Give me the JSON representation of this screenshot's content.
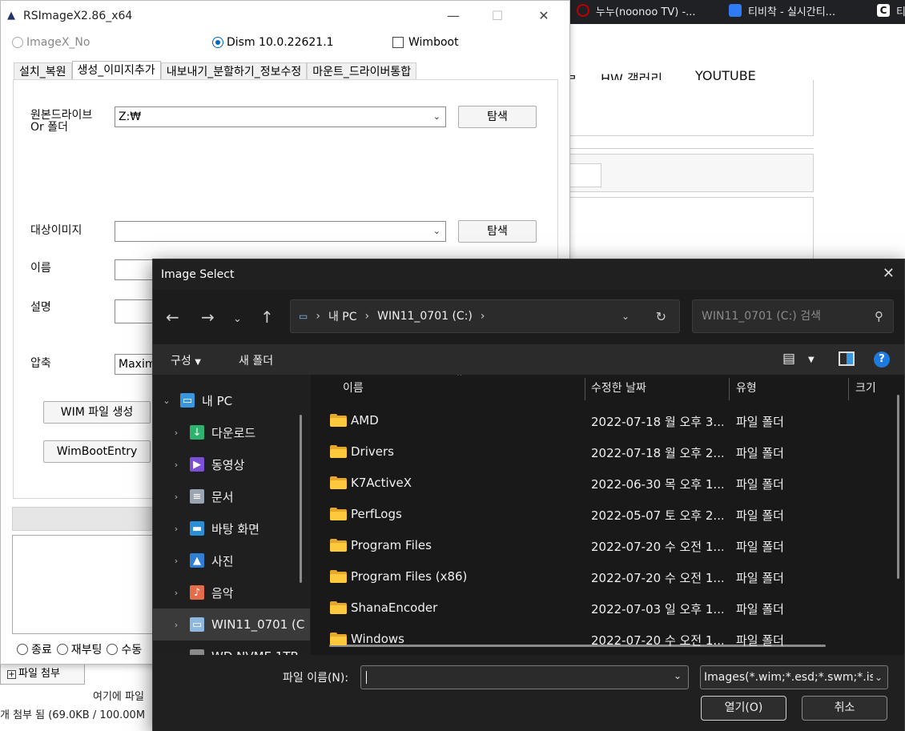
{
  "browser": {
    "tabs": [
      {
        "title": "누누(noonoo TV) -...",
        "icon_color": "#c00000"
      },
      {
        "title": "티비착 - 실시간티...",
        "icon_color": "#2f7bf5"
      },
      {
        "title": "티",
        "icon_color": "#111111"
      }
    ],
    "nav_links": [
      "HW 갤러리",
      "YOUTUBE"
    ],
    "partial_nav": "ㄹ",
    "attach_button": "파일 첨부",
    "attach_hint": "여기에 파일",
    "attach_status": "개 첨부 됨 (69.0KB / 100.00M"
  },
  "rsimagex": {
    "title": "RSImageX2.86_x64",
    "window_controls": {
      "minimize": "—",
      "maximize": "☐",
      "close": "✕"
    },
    "options": {
      "imagex_label": "ImageX_No",
      "dism_label": "Dism 10.0.22621.1",
      "wimboot_label": "Wimboot",
      "selected": "dism"
    },
    "tabs": [
      "설치_복원",
      "생성_이미지추가",
      "내보내기_분할하기_정보수정",
      "마운트_드라이버통합"
    ],
    "active_tab": "생성_이미지추가",
    "form": {
      "source_label_line1": "원본드라이브",
      "source_label_line2": "Or 폴더",
      "source_value": "Z:₩",
      "browse_label": "탐색",
      "target_label": "대상이미지",
      "target_value": "",
      "browse2_label": "탐색",
      "name_label": "이름",
      "desc_label": "설명",
      "compress_label": "압축",
      "compress_value": "Maxim",
      "create_wim_button": "WIM 파일 생성",
      "wimboot_entry_button": "WimBootEntry"
    },
    "bottom_options": [
      "종료",
      "재부팅",
      "수동"
    ]
  },
  "dialog": {
    "title": "Image Select",
    "address": {
      "root": "내 PC",
      "current": "WIN11_0701 (C:)"
    },
    "search_placeholder": "WIN11_0701 (C:) 검색",
    "toolbar": {
      "organize": "구성",
      "new_folder": "새 폴더"
    },
    "nav_items": [
      {
        "label": "내 PC",
        "icon": "pc-icon",
        "icon_color": "#3a96dd",
        "glyph": "▭"
      },
      {
        "label": "다운로드",
        "icon": "download-icon",
        "icon_color": "#2db36f",
        "glyph": "↓"
      },
      {
        "label": "동영상",
        "icon": "video-icon",
        "icon_color": "#7b4fd6",
        "glyph": "▶"
      },
      {
        "label": "문서",
        "icon": "document-icon",
        "icon_color": "#9aa4b2",
        "glyph": "≡"
      },
      {
        "label": "바탕 화면",
        "icon": "desktop-icon",
        "icon_color": "#2a8fd8",
        "glyph": "▬"
      },
      {
        "label": "사진",
        "icon": "photo-icon",
        "icon_color": "#2f7fd6",
        "glyph": "▲"
      },
      {
        "label": "음악",
        "icon": "music-icon",
        "icon_color": "#e56b4a",
        "glyph": "♪"
      },
      {
        "label": "WIN11_0701 (C",
        "icon": "drive-icon",
        "icon_color": "#8fb8e0",
        "glyph": "▭"
      },
      {
        "label": "WD NVME 1TB",
        "icon": "drive-icon",
        "icon_color": "#8a8a8a",
        "glyph": "▭"
      }
    ],
    "columns": [
      "이름",
      "수정한 날짜",
      "유형",
      "크기"
    ],
    "files": [
      {
        "name": "AMD",
        "modified": "2022-07-18 월 오후 3...",
        "type": "파일 폴더"
      },
      {
        "name": "Drivers",
        "modified": "2022-07-18 월 오후 2...",
        "type": "파일 폴더"
      },
      {
        "name": "K7ActiveX",
        "modified": "2022-06-30 목 오후 1...",
        "type": "파일 폴더"
      },
      {
        "name": "PerfLogs",
        "modified": "2022-05-07 토 오후 2...",
        "type": "파일 폴더"
      },
      {
        "name": "Program Files",
        "modified": "2022-07-20 수 오전 1...",
        "type": "파일 폴더"
      },
      {
        "name": "Program Files (x86)",
        "modified": "2022-07-20 수 오전 1...",
        "type": "파일 폴더"
      },
      {
        "name": "ShanaEncoder",
        "modified": "2022-07-03 일 오후 1...",
        "type": "파일 폴더"
      },
      {
        "name": "Windows",
        "modified": "2022-07-20 수 오전 1...",
        "type": "파일 폴더"
      }
    ],
    "filename_label": "파일 이름(N):",
    "filename_value": "",
    "filetype": "Images(*.wim;*.esd;*.swm;*.iso",
    "open_button": "열기(O)",
    "cancel_button": "취소"
  }
}
